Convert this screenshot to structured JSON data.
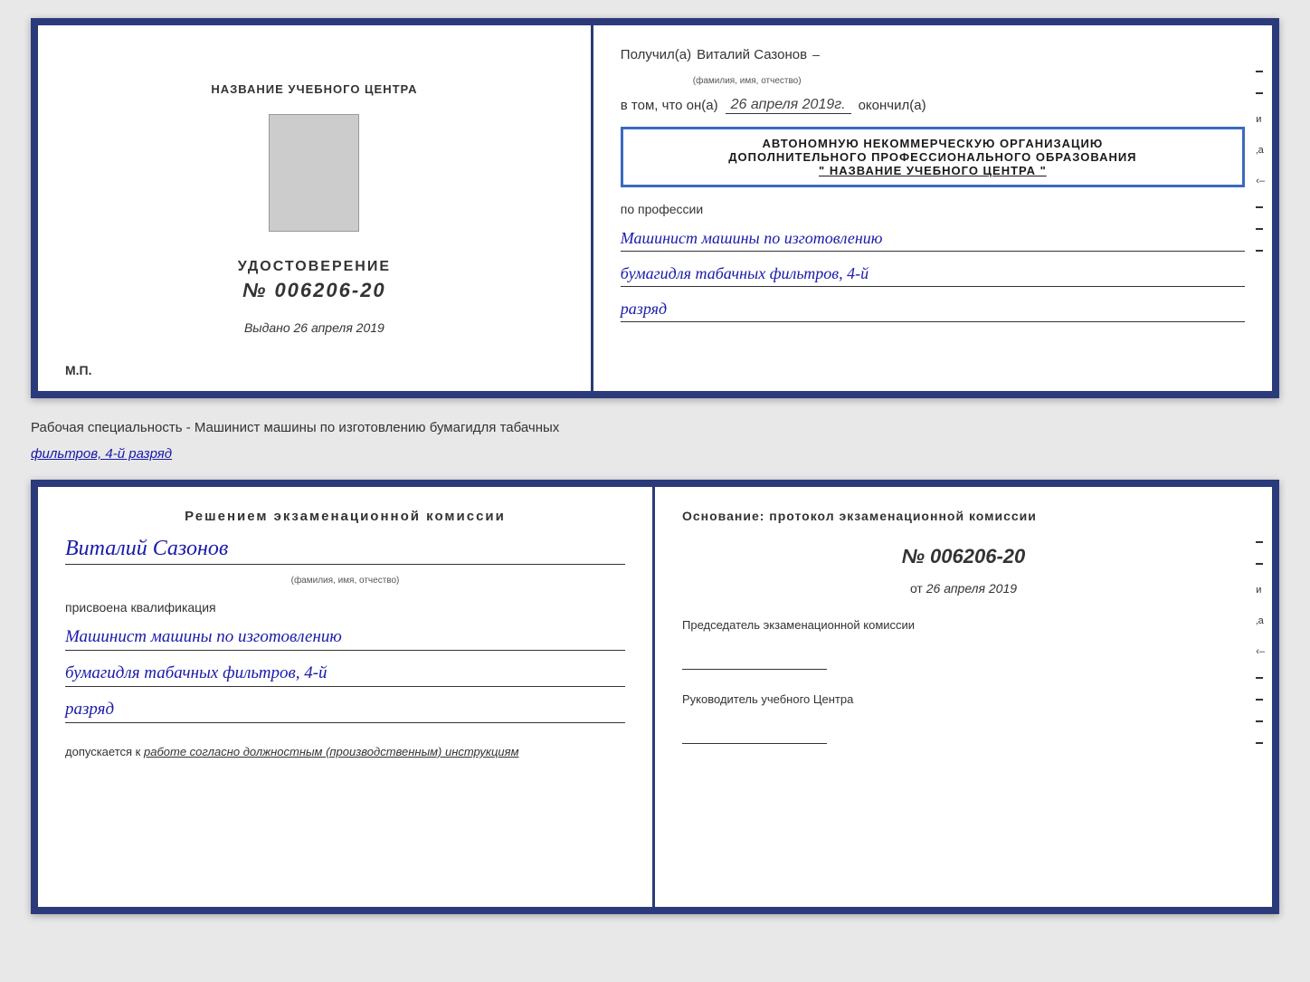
{
  "top_cert": {
    "left": {
      "center_heading": "НАЗВАНИЕ УЧЕБНОГО ЦЕНТРА",
      "cert_title": "УДОСТОВЕРЕНИЕ",
      "cert_number": "№ 006206-20",
      "issued_label": "Выдано",
      "issued_date": "26 апреля 2019",
      "mp_label": "М.П."
    },
    "right": {
      "recipient_prefix": "Получил(а)",
      "recipient_name": "Виталий Сазонов",
      "recipient_subtitle": "(фамилия, имя, отчество)",
      "vtom_prefix": "в том, что он(а)",
      "vtom_date": "26 апреля 2019г.",
      "vtom_suffix": "окончил(а)",
      "stamp_line1": "АВТОНОМНУЮ НЕКОММЕРЧЕСКУЮ ОРГАНИЗАЦИЮ",
      "stamp_line2": "ДОПОЛНИТЕЛЬНОГО ПРОФЕССИОНАЛЬНОГО ОБРАЗОВАНИЯ",
      "stamp_line3": "\" НАЗВАНИЕ УЧЕБНОГО ЦЕНТРА \"",
      "profession_label": "по профессии",
      "profession_line1": "Машинист машины по изготовлению",
      "profession_line2": "бумагидля табачных фильтров, 4-й",
      "profession_line3": "разряд"
    }
  },
  "specialist_label": "Рабочая специальность - Машинист машины по изготовлению бумагидля табачных",
  "specialist_label2": "фильтров, 4-й разряд",
  "bottom_cert": {
    "left": {
      "decision_heading": "Решением  экзаменационной  комиссии",
      "person_name": "Виталий Сазонов",
      "person_subtitle": "(фамилия, имя, отчество)",
      "assigned_label": "присвоена квалификация",
      "qual_line1": "Машинист машины по изготовлению",
      "qual_line2": "бумагидля табачных фильтров, 4-й",
      "qual_line3": "разряд",
      "admission_prefix": "допускается к",
      "admission_text": "работе согласно должностным (производственным) инструкциям"
    },
    "right": {
      "basis_label": "Основание: протокол экзаменационной  комиссии",
      "doc_number": "№  006206-20",
      "doc_date_prefix": "от",
      "doc_date": "26 апреля 2019",
      "chairman_label": "Председатель экзаменационной комиссии",
      "director_label": "Руководитель учебного Центра"
    }
  },
  "edge_marks": [
    "–",
    "–",
    "и",
    "‚а",
    "‹–",
    "–",
    "–",
    "–",
    "–"
  ]
}
